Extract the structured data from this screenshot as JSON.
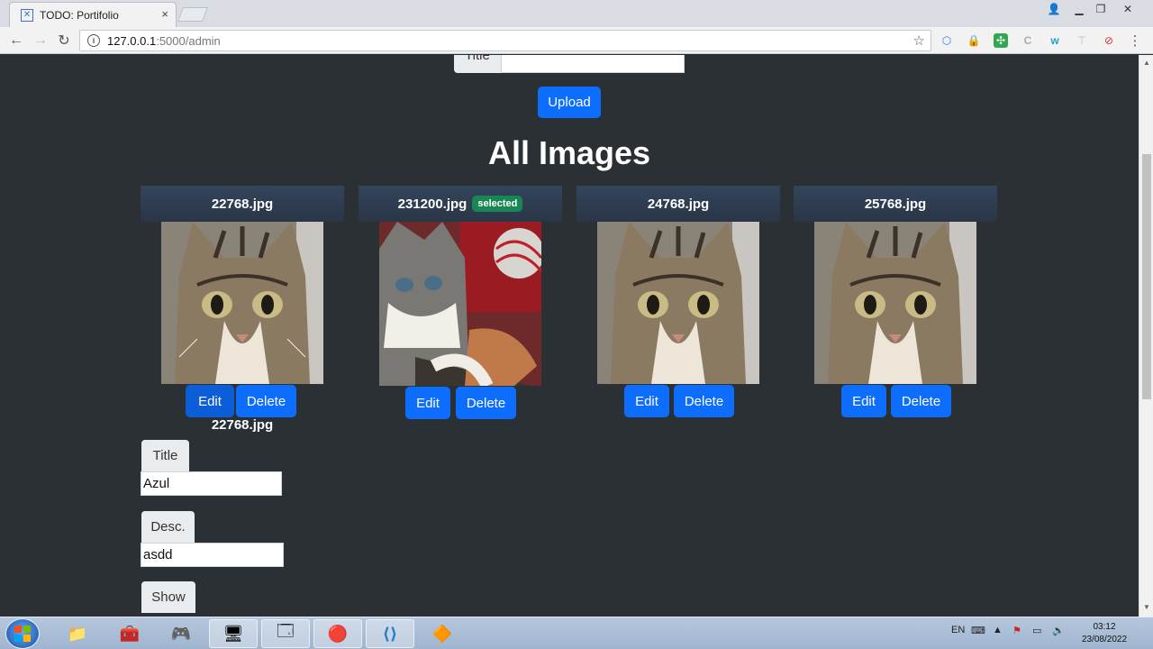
{
  "browser": {
    "tab_title": "TODO: Portifolio",
    "tab_close": "×",
    "url_host": "127.0.0.1",
    "url_path": ":5000/admin",
    "window_controls": [
      "user-icon",
      "minimize-icon",
      "restore-icon",
      "close-icon"
    ]
  },
  "page": {
    "title_label": "Title",
    "upload_button": "Upload",
    "heading": "All Images",
    "images": [
      {
        "filename": "22768.jpg",
        "badge": "",
        "edit": "Edit",
        "delete": "Delete"
      },
      {
        "filename": "231200.jpg",
        "badge": "selected",
        "edit": "Edit",
        "delete": "Delete"
      },
      {
        "filename": "24768.jpg",
        "badge": "",
        "edit": "Edit",
        "delete": "Delete"
      },
      {
        "filename": "25768.jpg",
        "badge": "",
        "edit": "Edit",
        "delete": "Delete"
      }
    ],
    "edit_form": {
      "filename": "22768.jpg",
      "title_label": "Title",
      "title_value": "Azul",
      "desc_label": "Desc.",
      "desc_value": "asdd",
      "show_label": "Show"
    }
  },
  "taskbar": {
    "language": "EN",
    "time": "03:12",
    "date": "23/08/2022"
  },
  "colors": {
    "page_background": "#2b3035",
    "primary_button": "#0d6efd",
    "badge_success": "#198754"
  }
}
